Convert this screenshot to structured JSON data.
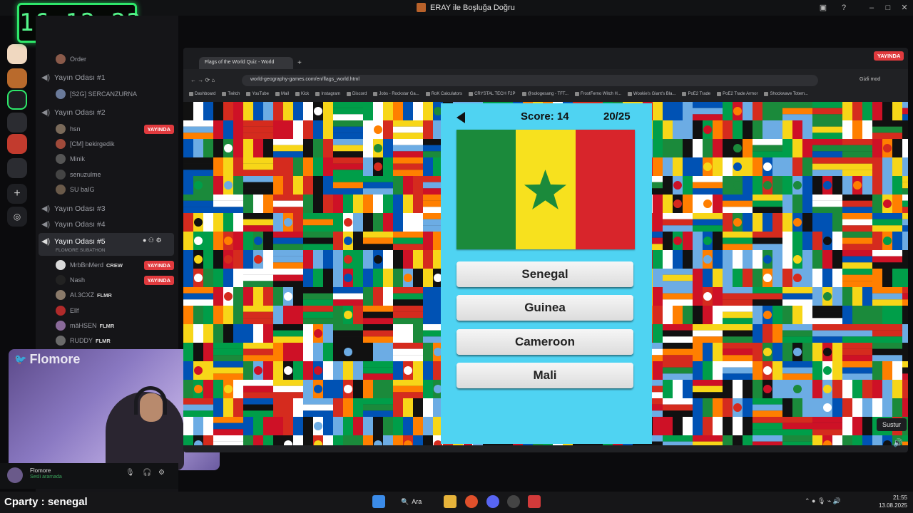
{
  "window": {
    "title": "ERAY ile Boşluğa Doğru"
  },
  "timer": "16:12:23",
  "sidebar": {
    "top_user": "Order",
    "channels": [
      {
        "name": "Yayın Odası #1",
        "users": [
          {
            "name": "[S2G] SERCANZURNA"
          }
        ]
      },
      {
        "name": "Yayın Odası #2",
        "users": [
          {
            "name": "hsn",
            "badge": "YAYINDA"
          },
          {
            "name": "[CM] bekirgedik"
          },
          {
            "name": "Minik"
          },
          {
            "name": "senuzulme"
          },
          {
            "name": "SU baIG"
          }
        ]
      },
      {
        "name": "Yayın Odası #3",
        "users": []
      },
      {
        "name": "Yayın Odası #4",
        "users": []
      },
      {
        "name": "Yayın Odası #5",
        "subtitle": "FLOMORE SUBATHON",
        "users": [
          {
            "name": "MrbBnMerd",
            "tag": "CREW",
            "badge": "YAYINDA"
          },
          {
            "name": "Nash",
            "badge": "YAYINDA"
          },
          {
            "name": "AI.3CXZ",
            "tag": "FLMR"
          },
          {
            "name": "Ellf"
          },
          {
            "name": "mäHSEN",
            "tag": "FLMR"
          },
          {
            "name": "RUDDY",
            "tag": "FLMR"
          }
        ]
      }
    ]
  },
  "webcam": {
    "brand": "Flomore"
  },
  "userbar": {
    "name": "Flomore",
    "status": "Sesli aramada"
  },
  "caption": "Cparty : senegal",
  "browser": {
    "tab_title": "Flags of the World Quiz - World",
    "url": "world-geography-games.com/en/flags_world.html",
    "live_badge": "YAYINDA",
    "incognito_label": "Gizli mod",
    "bookmarks": [
      "Dashboard",
      "Twitch",
      "YouTube",
      "Mail",
      "Kick",
      "Instagram",
      "Discord",
      "Jobs - Rockstar Ga...",
      "RoK Calculators",
      "CRYSTAL TECH F2P",
      "@sologesang - TFT...",
      "FrostFerno Witch H...",
      "Wookie's Giant's Bla...",
      "PoE2 Trade",
      "PoE2 Trade Armor",
      "Shockwave Totem..."
    ]
  },
  "quiz": {
    "score_label": "Score: 14",
    "progress": "20/25",
    "answers": [
      "Senegal",
      "Guinea",
      "Cameroon",
      "Mali"
    ]
  },
  "tooltip": "Sustur",
  "taskbar": {
    "search": "Ara",
    "time": "21:55",
    "date": "13.08.2025"
  },
  "colors": {
    "quiz_bg": "#4fd3f2",
    "timer_green": "#2ee86a",
    "live_red": "#e03a3e"
  }
}
